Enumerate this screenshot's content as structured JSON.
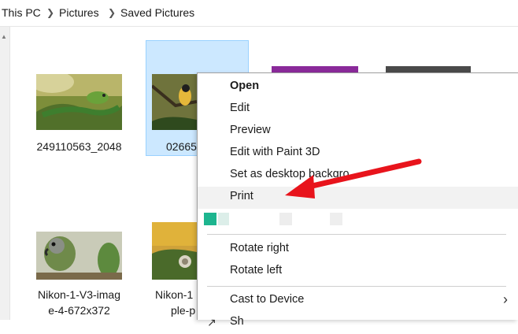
{
  "breadcrumb": [
    "This PC",
    "Pictures",
    "Saved Pictures"
  ],
  "files": [
    {
      "name": "249110563_2048",
      "icon": "photo-lizard"
    },
    {
      "name": "02665",
      "icon": "photo-bird",
      "selected": true
    },
    {
      "name": "Nikon-1-V3-image-4-672x372",
      "lines": [
        "Nikon-1-V3-imag",
        "e-4-672x372"
      ],
      "icon": "photo-parrot"
    },
    {
      "name": "Nikon-1",
      "lines": [
        "Nikon-1",
        "ple-p"
      ],
      "icon": "photo-snail"
    }
  ],
  "context_menu": {
    "items": [
      "Open",
      "Edit",
      "Preview",
      "Edit with Paint 3D",
      "Set as desktop backgro",
      "Print",
      "Rotate right",
      "Rotate left",
      "Cast to Device",
      "Sh"
    ],
    "highlighted": "Print"
  },
  "colors": {
    "accent": "#cce8ff",
    "arrow": "#e8141c",
    "menu_hover": "#f2f2f2"
  }
}
